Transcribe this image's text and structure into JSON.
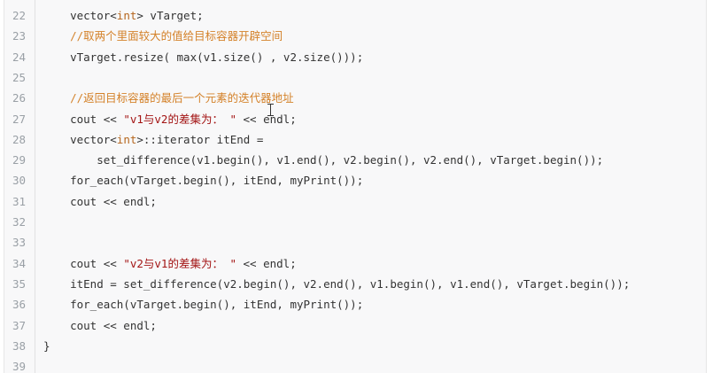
{
  "lines": [
    {
      "num": "22",
      "tokens": [
        {
          "t": "    vector<"
        },
        {
          "t": "int",
          "c": "kw"
        },
        {
          "t": "> vTarget;"
        }
      ]
    },
    {
      "num": "23",
      "tokens": [
        {
          "t": "    //取两个里面较大的值给目标容器开辟空间",
          "c": "com"
        }
      ]
    },
    {
      "num": "24",
      "tokens": [
        {
          "t": "    vTarget.resize( max(v1.size() , v2.size()));"
        }
      ]
    },
    {
      "num": "25",
      "tokens": []
    },
    {
      "num": "26",
      "tokens": [
        {
          "t": "    //返回目标容器的最后一个元素的迭代器地址",
          "c": "com"
        }
      ]
    },
    {
      "num": "27",
      "tokens": [
        {
          "t": "    cout << "
        },
        {
          "t": "\"v1与v2的差集为： \"",
          "c": "str"
        },
        {
          "t": " << endl;"
        }
      ]
    },
    {
      "num": "28",
      "tokens": [
        {
          "t": "    vector<"
        },
        {
          "t": "int",
          "c": "kw"
        },
        {
          "t": ">::iterator itEnd ="
        }
      ]
    },
    {
      "num": "29",
      "tokens": [
        {
          "t": "        set_difference(v1.begin(), v1.end(), v2.begin(), v2.end(), vTarget.begin());"
        }
      ]
    },
    {
      "num": "30",
      "tokens": [
        {
          "t": "    for_each(vTarget.begin(), itEnd, myPrint());"
        }
      ]
    },
    {
      "num": "31",
      "tokens": [
        {
          "t": "    cout << endl;"
        }
      ]
    },
    {
      "num": "32",
      "tokens": []
    },
    {
      "num": "33",
      "tokens": []
    },
    {
      "num": "34",
      "tokens": [
        {
          "t": "    cout << "
        },
        {
          "t": "\"v2与v1的差集为： \"",
          "c": "str"
        },
        {
          "t": " << endl;"
        }
      ]
    },
    {
      "num": "35",
      "tokens": [
        {
          "t": "    itEnd = set_difference(v2.begin(), v2.end(), v1.begin(), v1.end(), vTarget.begin());"
        }
      ]
    },
    {
      "num": "36",
      "tokens": [
        {
          "t": "    for_each(vTarget.begin(), itEnd, myPrint());"
        }
      ]
    },
    {
      "num": "37",
      "tokens": [
        {
          "t": "    cout << endl;"
        }
      ]
    },
    {
      "num": "38",
      "tokens": [
        {
          "t": "}"
        }
      ]
    },
    {
      "num": "39",
      "tokens": []
    }
  ],
  "colors": {
    "background": "#f8f8f9",
    "line_number": "#9aa0a6",
    "text": "#333333",
    "keyword": "#b5651d",
    "string": "#a31515",
    "comment": "#d4822a"
  },
  "cursor_icon": "i-beam-cursor"
}
